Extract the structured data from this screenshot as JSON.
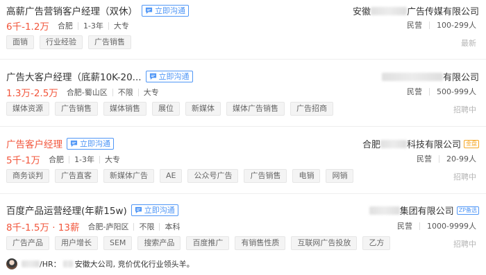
{
  "chat_label": "立即沟通",
  "jobs": [
    {
      "title": "高薪广告营销客户经理（双休）",
      "salary": "6千-1.2万",
      "location": "合肥",
      "experience": "1-3年",
      "education": "大专",
      "tags": [
        "面销",
        "行业经验",
        "广告销售"
      ],
      "company_prefix": "安徽",
      "company_suffix": "广告传媒有限公司",
      "company_badge": "",
      "company_type": "民营",
      "company_size": "100-299人",
      "status": "最新"
    },
    {
      "title": "广告大客户经理（底薪10K-20...",
      "salary": "1.3万-2.5万",
      "location": "合肥-蜀山区",
      "experience": "不限",
      "education": "大专",
      "tags": [
        "媒体资源",
        "广告销售",
        "媒体销售",
        "展位",
        "新媒体",
        "媒体广告销售",
        "广告招商"
      ],
      "company_prefix": "",
      "company_suffix": "有限公司",
      "company_badge": "",
      "company_type": "民营",
      "company_size": "500-999人",
      "status": "招聘中"
    },
    {
      "title": "广告客户经理",
      "salary": "5千-1万",
      "location": "合肥",
      "experience": "1-3年",
      "education": "大专",
      "tags": [
        "商务谈判",
        "广告直客",
        "新媒体广告",
        "AE",
        "公众号广告",
        "广告销售",
        "电销",
        "网销"
      ],
      "company_prefix": "合肥",
      "company_suffix": "科技有限公司",
      "company_badge": "金盘",
      "company_type": "民营",
      "company_size": "20-99人",
      "status": "招聘中"
    },
    {
      "title": "百度产品运营经理(年薪15w)",
      "salary": "8千-1.5万 · 13薪",
      "location": "合肥-庐阳区",
      "experience": "不限",
      "education": "本科",
      "tags": [
        "广告产品",
        "用户增长",
        "SEM",
        "搜索产品",
        "百度推广",
        "有销售性质",
        "互联网广告投放",
        "乙方"
      ],
      "company_prefix": "",
      "company_suffix": "集团有限公司",
      "company_badge": "ZP备选",
      "company_type": "民营",
      "company_size": "1000-9999人",
      "status": "招聘中"
    }
  ],
  "hr": {
    "label": "/HR：",
    "text": "安徽大公司, 竞价优化行业领头羊。"
  },
  "colors": {
    "salary": "#f2553b",
    "accent": "#4f96f6",
    "badge_gold": "#f5a623"
  }
}
